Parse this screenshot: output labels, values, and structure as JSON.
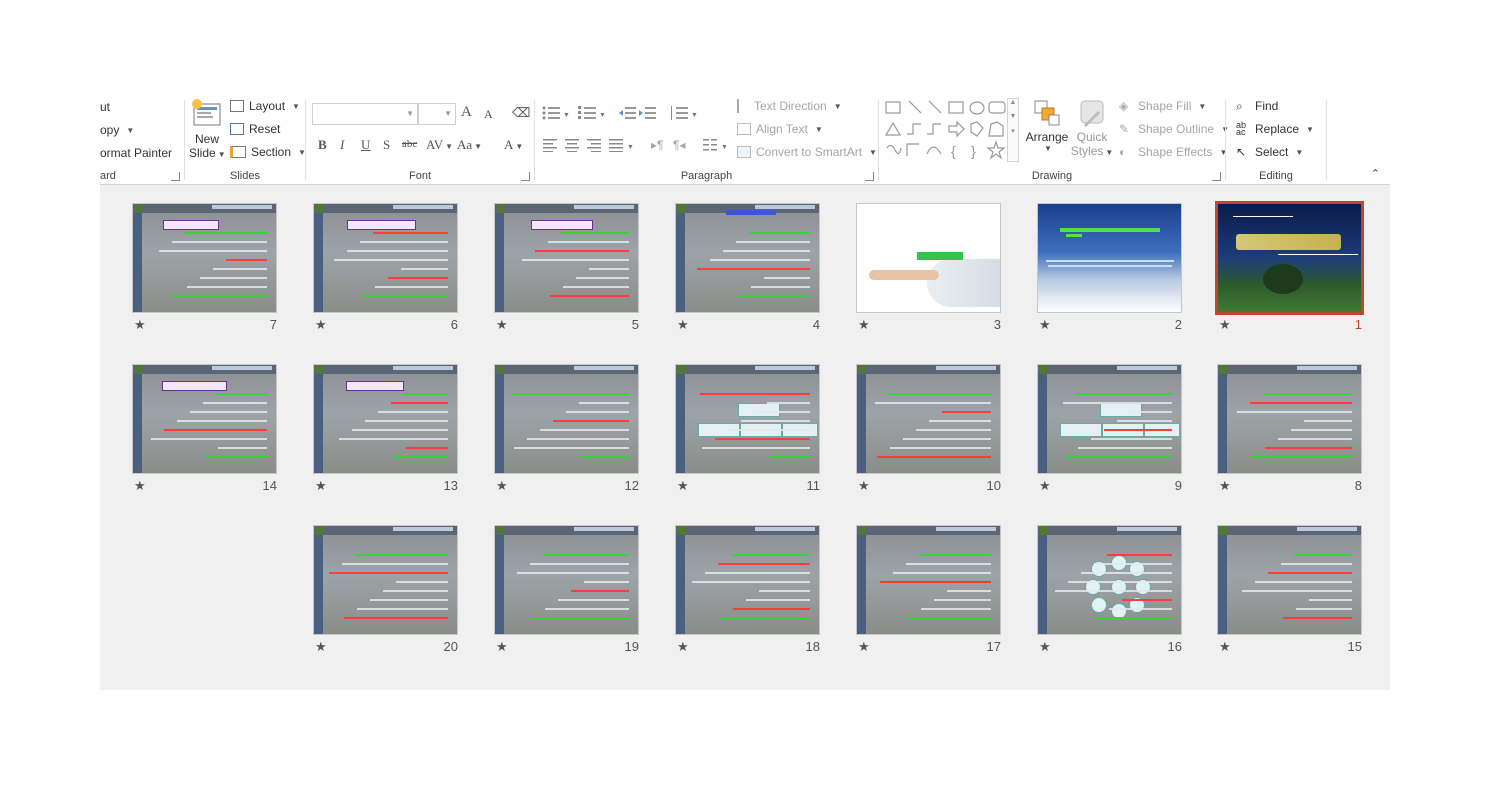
{
  "ribbon": {
    "clipboard": {
      "cut": "ut",
      "copy": "opy",
      "format_painter": "ormat Painter",
      "label": "ard"
    },
    "slides": {
      "new_slide_top": "New",
      "new_slide_bottom": "Slide",
      "layout": "Layout",
      "reset": "Reset",
      "section": "Section",
      "label": "Slides"
    },
    "font": {
      "label": "Font",
      "bold": "B",
      "italic": "I",
      "underline": "U",
      "shadow": "S",
      "strike": "abc",
      "spacing": "AV",
      "case": "Aa",
      "color": "A",
      "grow": "A",
      "shrink": "A"
    },
    "paragraph": {
      "text_direction": "Text Direction",
      "align_text": "Align Text",
      "convert": "Convert to SmartArt",
      "label": "Paragraph"
    },
    "drawing": {
      "arrange": "Arrange",
      "quick_top": "Quick",
      "quick_bottom": "Styles",
      "shape_fill": "Shape Fill",
      "shape_outline": "Shape Outline",
      "shape_effects": "Shape Effects",
      "label": "Drawing"
    },
    "editing": {
      "find": "Find",
      "replace": "Replace",
      "select": "Select",
      "label": "Editing"
    },
    "collapse_icon": "chevron-up-icon"
  },
  "colors": {
    "accent": "#c0462a",
    "sorter_bg": "#f0f0f0"
  },
  "slides": [
    {
      "num": "1",
      "star": "★",
      "theme": "night"
    },
    {
      "num": "2",
      "star": "★",
      "theme": "sky"
    },
    {
      "num": "3",
      "star": "★",
      "theme": "white"
    },
    {
      "num": "4",
      "star": "★",
      "theme": "quran"
    },
    {
      "num": "5",
      "star": "★",
      "theme": "quran"
    },
    {
      "num": "6",
      "star": "★",
      "theme": "quran"
    },
    {
      "num": "7",
      "star": "★",
      "theme": "quran"
    },
    {
      "num": "8",
      "star": "★",
      "theme": "quran"
    },
    {
      "num": "9",
      "star": "★",
      "theme": "quran"
    },
    {
      "num": "10",
      "star": "★",
      "theme": "quran"
    },
    {
      "num": "11",
      "star": "★",
      "theme": "quran"
    },
    {
      "num": "12",
      "star": "★",
      "theme": "quran"
    },
    {
      "num": "13",
      "star": "★",
      "theme": "quran"
    },
    {
      "num": "14",
      "star": "★",
      "theme": "quran"
    },
    {
      "num": "15",
      "star": "★",
      "theme": "quran"
    },
    {
      "num": "16",
      "star": "★",
      "theme": "quran"
    },
    {
      "num": "17",
      "star": "★",
      "theme": "quran"
    },
    {
      "num": "18",
      "star": "★",
      "theme": "quran"
    },
    {
      "num": "19",
      "star": "★",
      "theme": "quran"
    },
    {
      "num": "20",
      "star": "★",
      "theme": "quran"
    }
  ]
}
